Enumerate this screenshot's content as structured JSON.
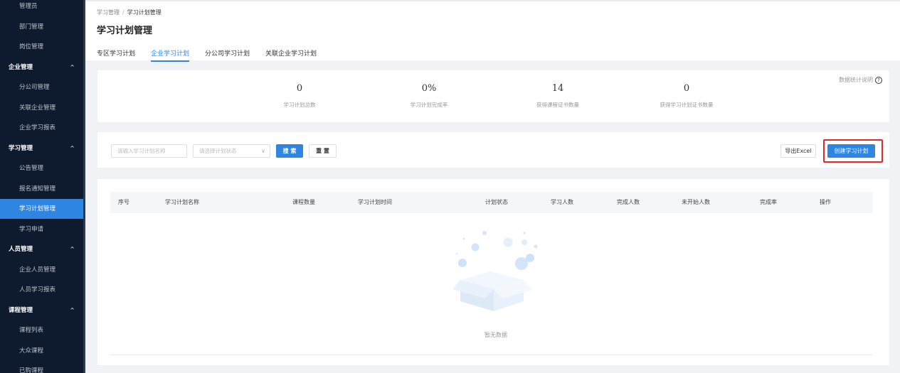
{
  "sidebar": {
    "rows": [
      {
        "label": "管理员",
        "type": "item"
      },
      {
        "label": "部门管理",
        "type": "item"
      },
      {
        "label": "岗位管理",
        "type": "item"
      },
      {
        "label": "企业管理",
        "type": "group",
        "caret": "^"
      },
      {
        "label": "分公司管理",
        "type": "item"
      },
      {
        "label": "关联企业管理",
        "type": "item"
      },
      {
        "label": "企业学习报表",
        "type": "item"
      },
      {
        "label": "学习管理",
        "type": "group",
        "caret": "^"
      },
      {
        "label": "公告管理",
        "type": "item"
      },
      {
        "label": "报名通知管理",
        "type": "item"
      },
      {
        "label": "学习计划管理",
        "type": "item",
        "active": true
      },
      {
        "label": "学习申请",
        "type": "item"
      },
      {
        "label": "人员管理",
        "type": "group",
        "caret": "^"
      },
      {
        "label": "企业人员管理",
        "type": "item"
      },
      {
        "label": "人员学习报表",
        "type": "item"
      },
      {
        "label": "课程管理",
        "type": "group",
        "caret": "^"
      },
      {
        "label": "课程列表",
        "type": "item"
      },
      {
        "label": "大众课程",
        "type": "item"
      },
      {
        "label": "已购课程",
        "type": "item"
      }
    ]
  },
  "breadcrumb": {
    "parent": "学习管理",
    "separator": "/",
    "current": "学习计划管理"
  },
  "page_title": "学习计划管理",
  "tabs": [
    {
      "label": "专区学习计划"
    },
    {
      "label": "企业学习计划",
      "active": true
    },
    {
      "label": "分公司学习计划"
    },
    {
      "label": "关联企业学习计划"
    }
  ],
  "stats": {
    "help_label": "数据统计说明",
    "help_icon": "?",
    "items": [
      {
        "value": "0",
        "label": "学习计划总数"
      },
      {
        "value": "0%",
        "label": "学习计划完成率"
      },
      {
        "value": "14",
        "label": "获得课程证书数量"
      },
      {
        "value": "0",
        "label": "获得学习计划证书数量"
      }
    ]
  },
  "filters": {
    "name_placeholder": "请输入学习计划名称",
    "status_placeholder": "请选择计划状态",
    "status_chevron": "∨",
    "search_label": "搜 索",
    "reset_label": "重 置",
    "export_label": "导出Excel",
    "create_label": "创建学习计划"
  },
  "table": {
    "columns": [
      "序号",
      "学习计划名称",
      "课程数量",
      "学习计划时间",
      "计划状态",
      "学习人数",
      "完成人数",
      "未开始人数",
      "完成率",
      "操作"
    ],
    "empty_text": "暂无数据"
  },
  "colors": {
    "sidebar_bg": "#0e1b2e",
    "accent": "#2f86e0",
    "highlight": "#e02a2a"
  }
}
